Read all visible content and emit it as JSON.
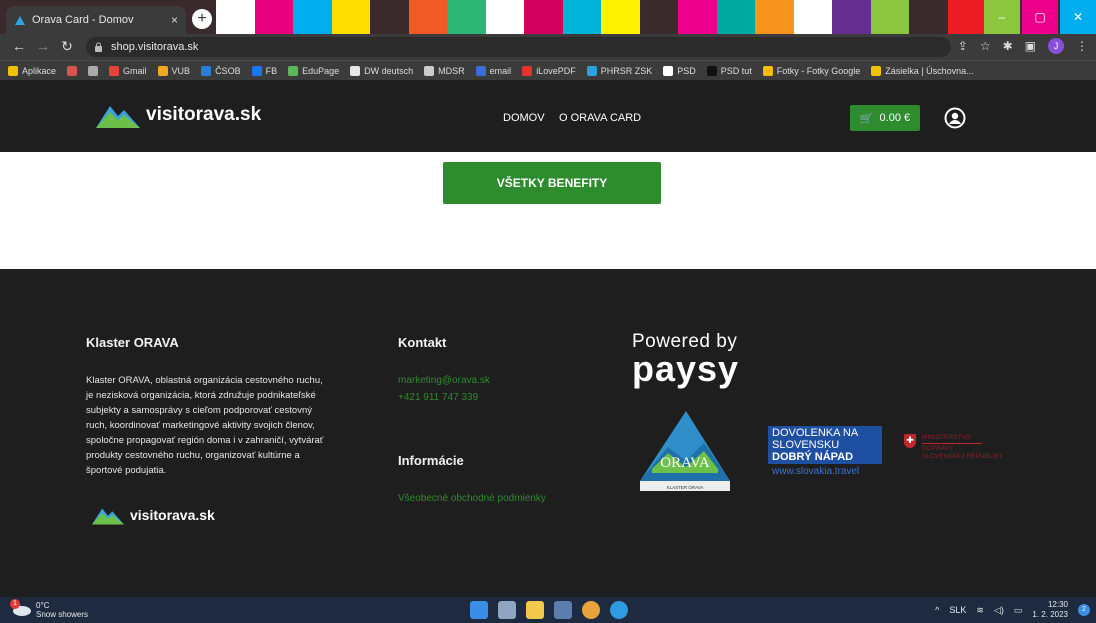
{
  "browser": {
    "tab_title": "Orava Card - Domov",
    "tab_close": "×",
    "new_tab": "+",
    "url": "shop.visitorava.sk",
    "stripe_colors": [
      "#ffffff",
      "#e6007e",
      "#00aeef",
      "#ffde00",
      "#3b2a2b",
      "#f15a24",
      "#2bb673",
      "#ffffff",
      "#d1005c",
      "#00b3d9",
      "#fff200",
      "#3b2a2b",
      "#ec008c",
      "#00a99d",
      "#f7941d",
      "#ffffff",
      "#662d91",
      "#8cc63f",
      "#3b2a2b",
      "#ed1c24"
    ],
    "window_controls": {
      "minimize": "–",
      "maximize": "▢",
      "close": "✕"
    },
    "profile_initial": "J"
  },
  "bookmarks": [
    {
      "label": "Aplikace",
      "color": "#f2c200"
    },
    {
      "label": "",
      "color": "#d9534f"
    },
    {
      "label": "",
      "color": "#aaaaaa"
    },
    {
      "label": "Gmail",
      "color": "#ea4335"
    },
    {
      "label": "VUB",
      "color": "#f5a623"
    },
    {
      "label": "ČSOB",
      "color": "#2a7fd4"
    },
    {
      "label": "FB",
      "color": "#1877f2"
    },
    {
      "label": "EduPage",
      "color": "#5bb85b"
    },
    {
      "label": "DW deutsch",
      "color": "#e6e6e6"
    },
    {
      "label": "MDSR",
      "color": "#cccccc"
    },
    {
      "label": "email",
      "color": "#3b6fd8"
    },
    {
      "label": "iLovePDF",
      "color": "#e5322d"
    },
    {
      "label": "PHRSR ZSK",
      "color": "#2aa3e0"
    },
    {
      "label": "PSD",
      "color": "#ffffff"
    },
    {
      "label": "PSD tut",
      "color": "#111111"
    },
    {
      "label": "Fotky - Fotky Google",
      "color": "#fbbc05"
    },
    {
      "label": "Zásielka | Úschovna...",
      "color": "#f2c200"
    }
  ],
  "header": {
    "logo_text": "visitorava.sk",
    "nav": [
      "DOMOV",
      "O ORAVA CARD"
    ],
    "cart_amount": "0.00 €"
  },
  "main": {
    "benefits_button": "VŠETKY BENEFITY"
  },
  "footer": {
    "about_heading": "Klaster ORAVA",
    "about_text": "Klaster ORAVA, oblastná organizácia cestovného ruchu, je nezisková organizácia, ktorá združuje podnikateľské subjekty a samosprávy s cieľom podporovať cestovný ruch, koordinovať marketingové aktivity svojich členov, spoločne propagovať región doma i v zahraničí, vytvárať produkty cestovného ruchu, organizovať kultúrne a športové podujatia.",
    "about_logo": "visitorava.sk",
    "contact_heading": "Kontakt",
    "contact_email": "marketing@orava.sk",
    "contact_phone": "+421 911 747 339",
    "info_heading": "Informácie",
    "info_link": "Všeobecné obchodné podmienky",
    "powered_by": "Powered by",
    "paysy": "paysy",
    "orava_badge_text": "ORAVA",
    "orava_badge_caption": "KLASTER ORAVA",
    "dovolenka_line1": "DOVOLENKA NA",
    "dovolenka_line2": "SLOVENSKU",
    "dovolenka_line3": "DOBRÝ NÁPAD",
    "dovolenka_url": "www.slovakia.travel",
    "ministry_line1": "MINISTERSTVO",
    "ministry_line2": "DOPRAVY",
    "ministry_line3": "SLOVENSKEJ REPUBLIKY"
  },
  "taskbar": {
    "temperature": "0°C",
    "weather": "Snow showers",
    "weather_badge": "1",
    "language": "SLK",
    "time": "12:30",
    "date": "1. 2. 2023",
    "notifications": "2"
  }
}
